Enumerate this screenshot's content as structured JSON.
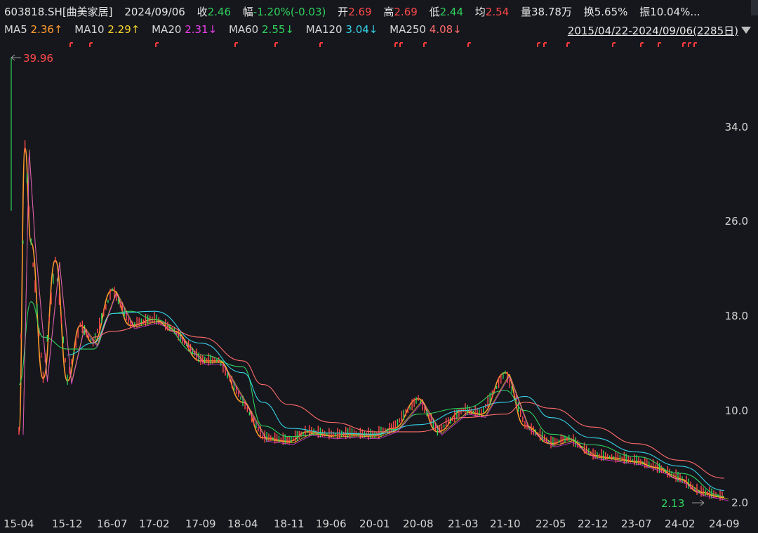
{
  "header": {
    "code": "603818.SH[曲美家居]",
    "date": "2024/09/06",
    "close_label": "收",
    "close_value": "2.46",
    "change_label": "幅",
    "change_value": "-1.20%(-0.03)",
    "open_label": "开",
    "open_value": "2.69",
    "high_label": "高",
    "high_value": "2.69",
    "low_label": "低",
    "low_value": "2.44",
    "avg_label": "均",
    "avg_value": "2.54",
    "volume_label": "量",
    "volume_value": "38.78万",
    "turnover_label": "换",
    "turnover_value": "5.65%",
    "amplitude_label": "振",
    "amplitude_value": "10.04%..."
  },
  "ma_legend": [
    {
      "label": "MA5",
      "value": "2.36↑",
      "color": "#ff9a2e"
    },
    {
      "label": "MA10",
      "value": "2.29↑",
      "color": "#f5d22b"
    },
    {
      "label": "MA20",
      "value": "2.31↓",
      "color": "#e83fe8"
    },
    {
      "label": "MA60",
      "value": "2.55↓",
      "color": "#2fd15d"
    },
    {
      "label": "MA120",
      "value": "3.04↓",
      "color": "#35d2e8"
    },
    {
      "label": "MA250",
      "value": "4.08↓",
      "color": "#ff6b6b"
    }
  ],
  "range_text": "2015/04/22-2024/09/06(2285日)",
  "chart_data": {
    "type": "line",
    "title": "",
    "y_ticks": [
      "34.0",
      "26.0",
      "18.0",
      "10.0",
      "2.0"
    ],
    "x_ticks": [
      "15-04",
      "15-12",
      "16-07",
      "17-02",
      "17-09",
      "18-04",
      "18-11",
      "19-06",
      "20-01",
      "20-08",
      "21-03",
      "21-10",
      "22-05",
      "22-12",
      "23-07",
      "24-02",
      "24-09"
    ],
    "max_annotation": "39.96",
    "min_annotation": "2.13",
    "ylim": [
      2.0,
      40.0
    ],
    "grid": false,
    "series": [
      {
        "name": "MA5",
        "color": "#ff9a2e",
        "x": [
          "15-04",
          "15-05",
          "15-06",
          "15-08",
          "15-10",
          "15-12",
          "16-02",
          "16-04",
          "16-07",
          "16-10",
          "17-02",
          "17-05",
          "17-09",
          "17-12",
          "18-04",
          "18-07",
          "18-11",
          "19-02",
          "19-06",
          "19-09",
          "20-01",
          "20-04",
          "20-08",
          "20-11",
          "21-03",
          "21-06",
          "21-10",
          "22-01",
          "22-05",
          "22-08",
          "22-12",
          "23-03",
          "23-07",
          "23-10",
          "24-02",
          "24-05",
          "24-09"
        ],
        "values": [
          8.0,
          32.0,
          24.0,
          12.5,
          22.5,
          12.3,
          17.0,
          15.5,
          20.0,
          17.0,
          17.5,
          16.5,
          14.0,
          14.0,
          10.5,
          7.5,
          7.2,
          8.0,
          7.7,
          7.8,
          7.7,
          8.3,
          10.8,
          8.0,
          9.8,
          9.5,
          13.0,
          8.5,
          7.0,
          7.4,
          6.0,
          5.8,
          5.5,
          5.0,
          4.0,
          2.9,
          2.46
        ]
      },
      {
        "name": "MA60",
        "color": "#2fd15d",
        "x": [
          "15-04",
          "15-06",
          "15-08",
          "15-12",
          "16-04",
          "16-07",
          "16-10",
          "17-02",
          "17-09",
          "18-04",
          "18-07",
          "18-11",
          "19-06",
          "20-01",
          "20-04",
          "20-08",
          "21-03",
          "21-10",
          "22-01",
          "22-05",
          "22-12",
          "23-07",
          "24-02",
          "24-09"
        ],
        "values": [
          12.0,
          19.0,
          16.0,
          15.0,
          15.0,
          18.0,
          18.2,
          17.5,
          14.5,
          13.5,
          8.5,
          7.6,
          7.9,
          7.8,
          8.2,
          9.5,
          10.0,
          11.5,
          9.8,
          7.8,
          6.9,
          5.9,
          4.5,
          2.55
        ]
      },
      {
        "name": "MA120",
        "color": "#35d2e8",
        "x": [
          "15-12",
          "16-04",
          "16-07",
          "17-02",
          "17-09",
          "18-04",
          "18-07",
          "18-11",
          "19-06",
          "20-01",
          "20-08",
          "21-03",
          "21-10",
          "22-01",
          "22-05",
          "22-12",
          "23-07",
          "24-02",
          "24-09"
        ],
        "values": [
          14.5,
          15.5,
          18.0,
          18.2,
          15.5,
          13.0,
          10.5,
          8.3,
          7.9,
          7.8,
          8.6,
          9.8,
          10.5,
          11.0,
          9.2,
          7.5,
          6.3,
          5.1,
          3.04
        ]
      },
      {
        "name": "MA250",
        "color": "#ff6b6b",
        "x": [
          "16-04",
          "16-07",
          "17-02",
          "17-09",
          "18-04",
          "18-07",
          "18-11",
          "19-06",
          "20-01",
          "20-08",
          "21-03",
          "21-10",
          "22-01",
          "22-05",
          "22-12",
          "23-07",
          "24-02",
          "24-09"
        ],
        "values": [
          16.0,
          16.5,
          17.3,
          16.0,
          14.0,
          12.0,
          10.3,
          8.8,
          8.0,
          8.0,
          9.2,
          9.5,
          10.5,
          10.0,
          8.4,
          7.0,
          5.6,
          4.08
        ]
      }
    ]
  }
}
